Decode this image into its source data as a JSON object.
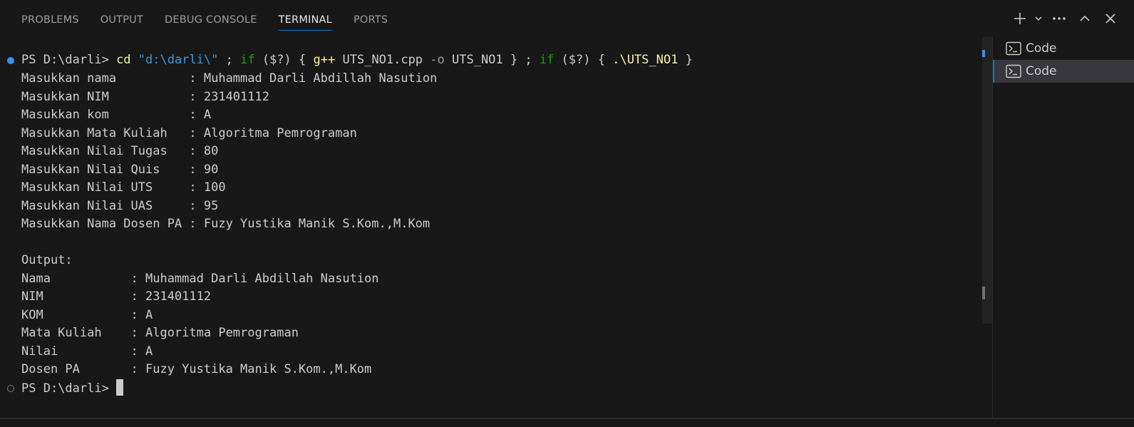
{
  "panel": {
    "tabs": [
      {
        "label": "PROBLEMS"
      },
      {
        "label": "OUTPUT"
      },
      {
        "label": "DEBUG CONSOLE"
      },
      {
        "label": "TERMINAL"
      },
      {
        "label": "PORTS"
      }
    ],
    "active_tab": "TERMINAL",
    "actions": [
      "plus-icon",
      "chevron-down-icon",
      "ellipsis-icon",
      "chevron-up-icon",
      "close-icon"
    ]
  },
  "terminal": {
    "command": {
      "prompt": "PS D:\\darli> ",
      "cd": "cd",
      "path": "\"d:\\darli\\\"",
      "sep1": " ; ",
      "if1": "if",
      "cond1": " ($?) ",
      "brace_open1": "{ ",
      "gpp": "g++",
      "args1": " UTS_NO1.cpp ",
      "flag": "-o",
      "args2": " UTS_NO1 } ; ",
      "if2": "if",
      "cond2": " ($?) ",
      "brace_open2": "{ ",
      "run": ".\\UTS_NO1",
      "brace_close": " }"
    },
    "lines": [
      "Masukkan nama          : Muhammad Darli Abdillah Nasution",
      "Masukkan NIM           : 231401112",
      "Masukkan kom           : A",
      "Masukkan Mata Kuliah   : Algoritma Pemrograman",
      "Masukkan Nilai Tugas   : 80",
      "Masukkan Nilai Quis    : 90",
      "Masukkan Nilai UTS     : 100",
      "Masukkan Nilai UAS     : 95",
      "Masukkan Nama Dosen PA : Fuzy Yustika Manik S.Kom.,M.Kom",
      "",
      "Output:",
      "Nama           : Muhammad Darli Abdillah Nasution",
      "NIM            : 231401112",
      "KOM            : A",
      "Mata Kuliah    : Algoritma Pemrograman",
      "Nilai          : A",
      "Dosen PA       : Fuzy Yustika Manik S.Kom.,M.Kom"
    ],
    "final_prompt": "PS D:\\darli> "
  },
  "terminal_list": {
    "items": [
      {
        "label": "Code",
        "icon": "terminal-icon",
        "selected": false
      },
      {
        "label": "Code",
        "icon": "terminal-icon",
        "selected": true
      }
    ]
  },
  "colors": {
    "background": "#181818",
    "accent": "#0078d4",
    "yellow": "#f9f1a5",
    "cyan": "#3a96dd",
    "green": "#13a10e"
  }
}
